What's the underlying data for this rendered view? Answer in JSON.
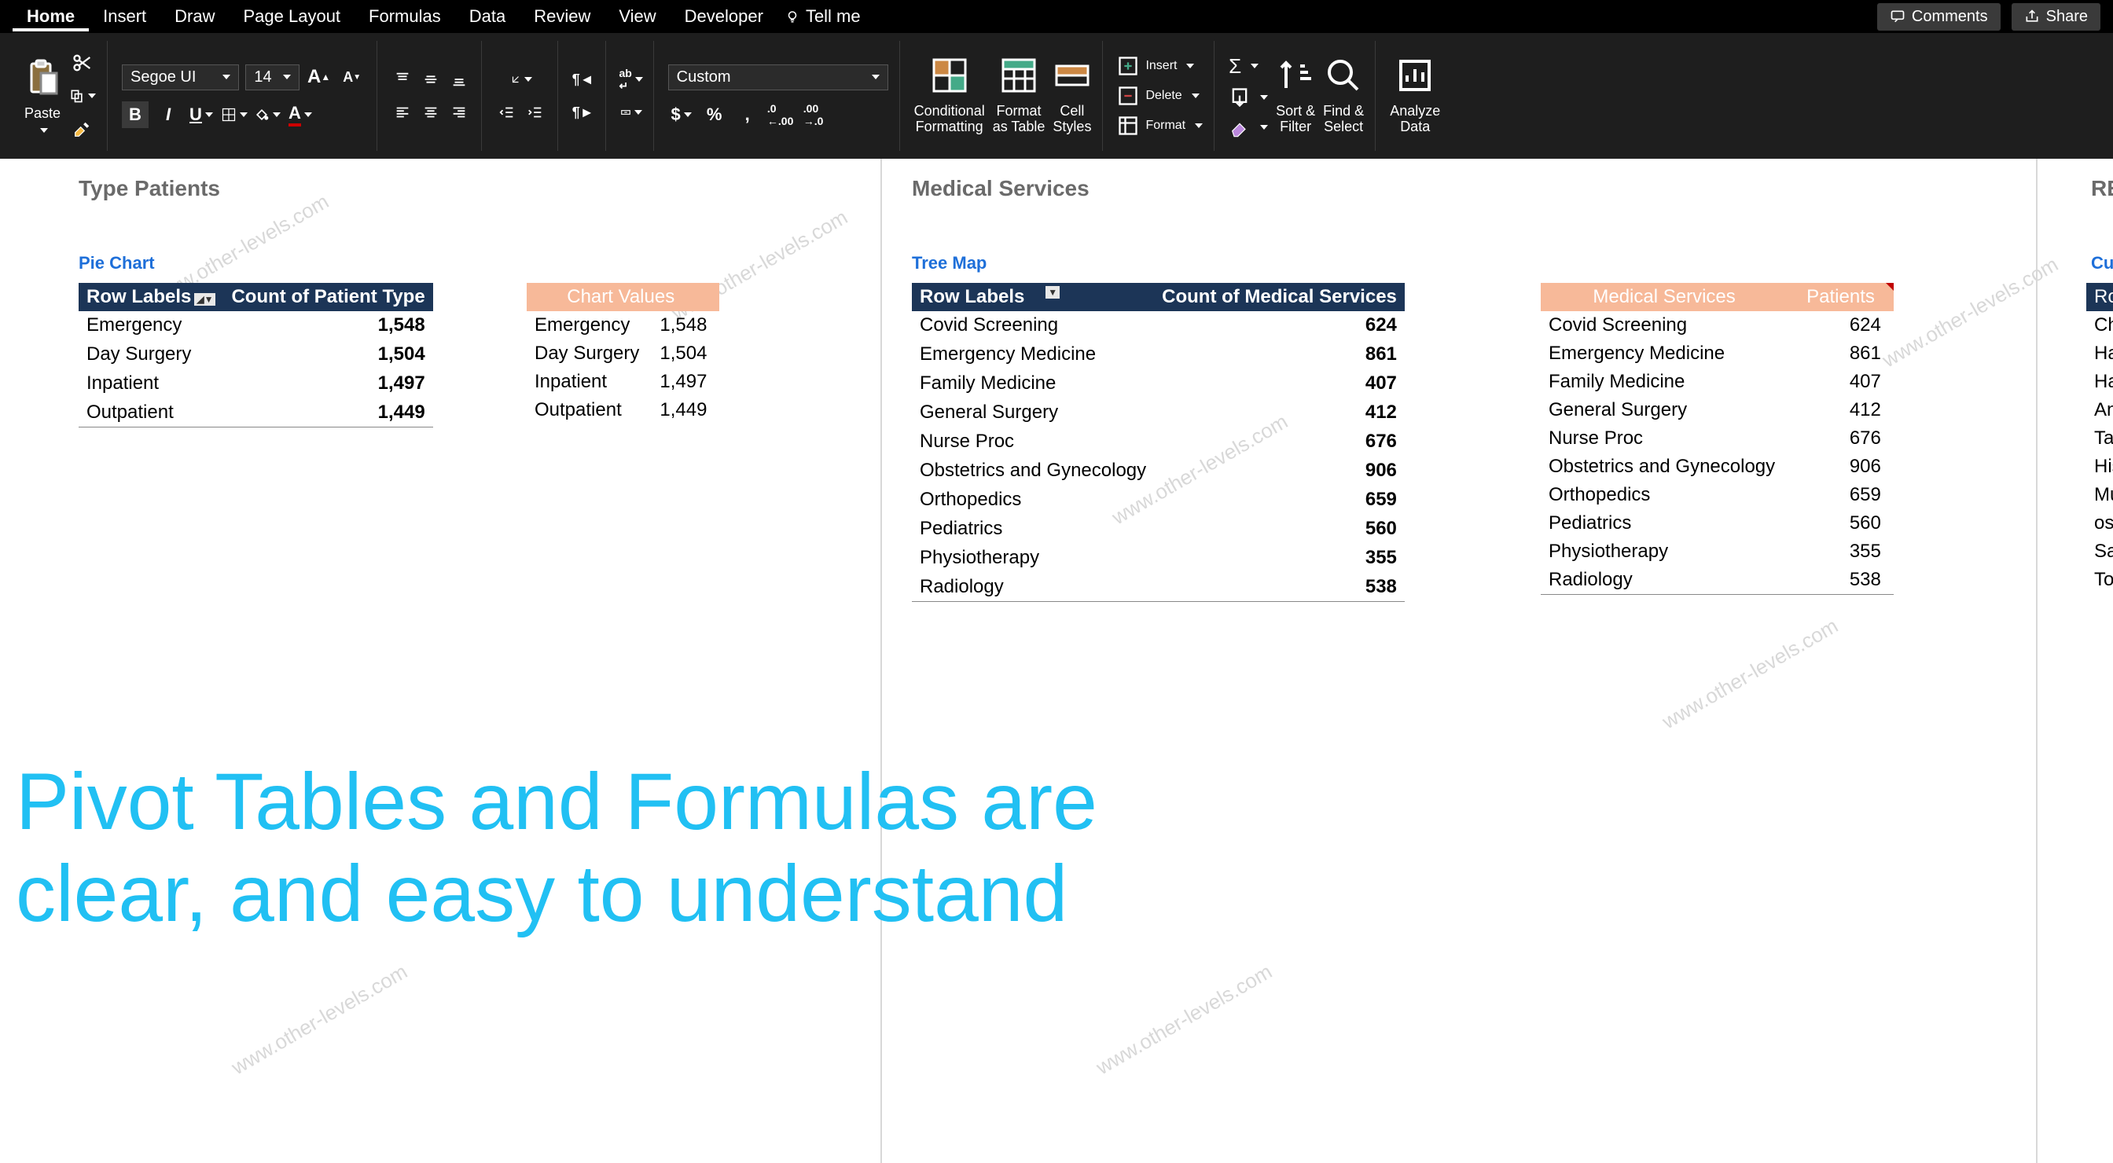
{
  "tabs": [
    "Home",
    "Insert",
    "Draw",
    "Page Layout",
    "Formulas",
    "Data",
    "Review",
    "View",
    "Developer"
  ],
  "tell_me": "Tell me",
  "top_buttons": {
    "comments": "Comments",
    "share": "Share"
  },
  "clipboard": {
    "paste": "Paste"
  },
  "font": {
    "name": "Segoe UI",
    "size": "14"
  },
  "number_format": "Custom",
  "styles": {
    "cond": "Conditional\nFormatting",
    "table": "Format\nas Table",
    "cell": "Cell\nStyles"
  },
  "cells": {
    "insert": "Insert",
    "delete": "Delete",
    "format": "Format"
  },
  "editing": {
    "sort": "Sort &\nFilter",
    "find": "Find &\nSelect"
  },
  "analyze": "Analyze\nData",
  "sections": {
    "type_patients": "Type Patients",
    "medical_services": "Medical Services",
    "re": "RE"
  },
  "chart_labels": {
    "pie": "Pie Chart",
    "tree": "Tree Map",
    "cul": "Cul"
  },
  "pivot1": {
    "headers": [
      "Row Labels",
      "Count of Patient Type"
    ],
    "rows": [
      [
        "Emergency",
        "1,548"
      ],
      [
        "Day Surgery",
        "1,504"
      ],
      [
        "Inpatient",
        "1,497"
      ],
      [
        "Outpatient",
        "1,449"
      ]
    ]
  },
  "chart_values_header": "Chart Values",
  "chart_values": [
    [
      "Emergency",
      "1,548"
    ],
    [
      "Day Surgery",
      "1,504"
    ],
    [
      "Inpatient",
      "1,497"
    ],
    [
      "Outpatient",
      "1,449"
    ]
  ],
  "pivot2": {
    "headers": [
      "Row Labels",
      "Count of Medical Services"
    ],
    "rows": [
      [
        "Covid Screening",
        "624"
      ],
      [
        "Emergency Medicine",
        "861"
      ],
      [
        "Family Medicine",
        "407"
      ],
      [
        "General Surgery",
        "412"
      ],
      [
        "Nurse Proc",
        "676"
      ],
      [
        "Obstetrics and Gynecology",
        "906"
      ],
      [
        "Orthopedics",
        "659"
      ],
      [
        "Pediatrics",
        "560"
      ],
      [
        "Physiotherapy",
        "355"
      ],
      [
        "Radiology",
        "538"
      ]
    ]
  },
  "ms_table": {
    "headers": [
      "Medical Services",
      "Patients"
    ],
    "rows": [
      [
        "Covid Screening",
        "624"
      ],
      [
        "Emergency Medicine",
        "861"
      ],
      [
        "Family Medicine",
        "407"
      ],
      [
        "General Surgery",
        "412"
      ],
      [
        "Nurse Proc",
        "676"
      ],
      [
        "Obstetrics and Gynecology",
        "906"
      ],
      [
        "Orthopedics",
        "659"
      ],
      [
        "Pediatrics",
        "560"
      ],
      [
        "Physiotherapy",
        "355"
      ],
      [
        "Radiology",
        "538"
      ]
    ]
  },
  "cutoff_rows": [
    "Rov",
    "Cha",
    "Ha",
    "Ha",
    "An",
    "Tas",
    "His",
    "Mu",
    "ost",
    "Sal",
    "To"
  ],
  "overlay": "Pivot Tables and Formulas are\nclear, and easy to understand",
  "watermark": "www.other-levels.com",
  "chart_data": [
    {
      "type": "table",
      "title": "Type Patients - Count of Patient Type",
      "categories": [
        "Emergency",
        "Day Surgery",
        "Inpatient",
        "Outpatient"
      ],
      "values": [
        1548,
        1504,
        1497,
        1449
      ]
    },
    {
      "type": "table",
      "title": "Medical Services - Count of Medical Services",
      "categories": [
        "Covid Screening",
        "Emergency Medicine",
        "Family Medicine",
        "General Surgery",
        "Nurse Proc",
        "Obstetrics and Gynecology",
        "Orthopedics",
        "Pediatrics",
        "Physiotherapy",
        "Radiology"
      ],
      "values": [
        624,
        861,
        407,
        412,
        676,
        906,
        659,
        560,
        355,
        538
      ]
    }
  ]
}
